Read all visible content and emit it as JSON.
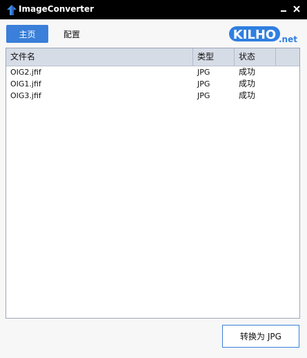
{
  "window": {
    "title": "ImageConverter",
    "minimize_glyph": "▬",
    "close_glyph": "✕"
  },
  "nav": {
    "home_label": "主页",
    "config_label": "配置"
  },
  "logo": {
    "text": "KILHO",
    "suffix": ".net"
  },
  "table": {
    "headers": [
      "文件名",
      "类型",
      "状态"
    ],
    "rows": [
      {
        "name": "OIG2.jfif",
        "type": "JPG",
        "status": "成功"
      },
      {
        "name": "OIG1.jfif",
        "type": "JPG",
        "status": "成功"
      },
      {
        "name": "OIG3.jfif",
        "type": "JPG",
        "status": "成功"
      }
    ]
  },
  "actions": {
    "convert_label": "转换为 JPG"
  },
  "icons": {
    "app": "upload-arrow-icon",
    "minimize": "minimize-icon",
    "close": "close-icon"
  },
  "colors": {
    "accent": "#3a7fd9",
    "titlebar": "#000000",
    "header_bg": "#d6dce6"
  }
}
